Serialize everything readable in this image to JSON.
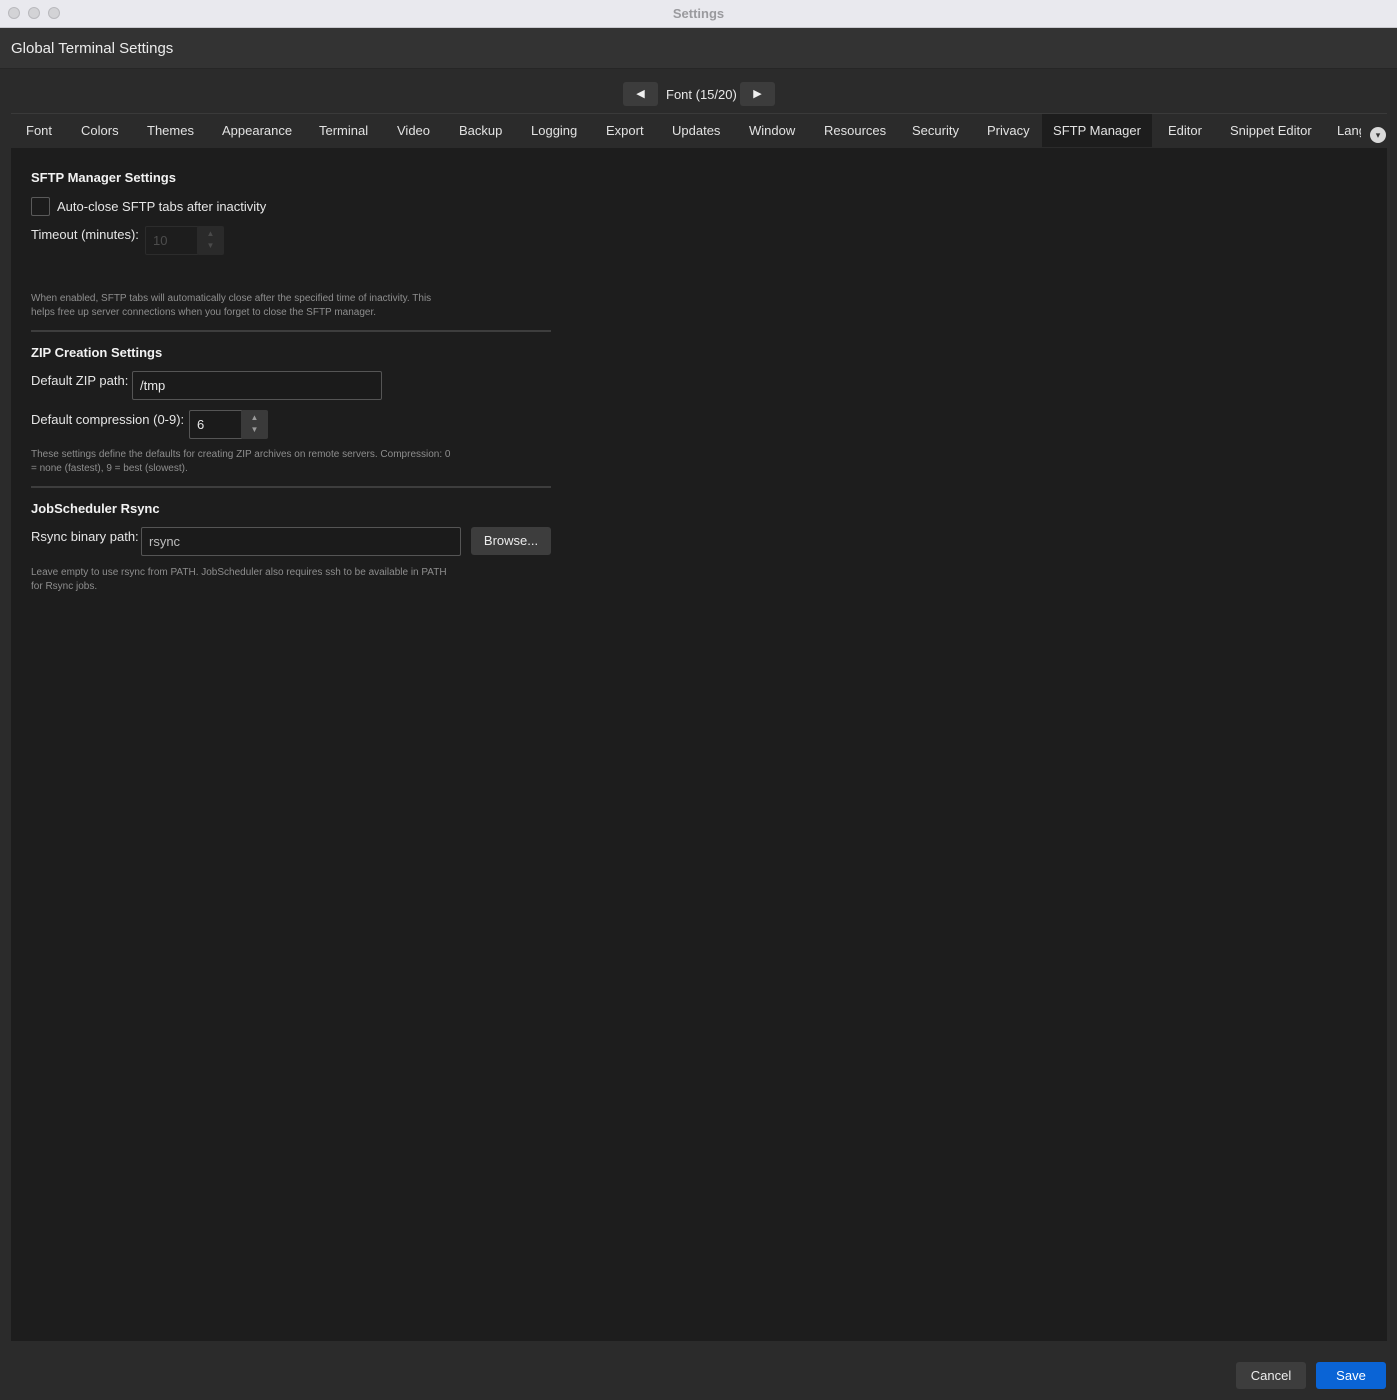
{
  "window": {
    "title": "Settings"
  },
  "header": {
    "title": "Global Terminal Settings"
  },
  "pager": {
    "prev": "◀",
    "label": "Font (15/20)",
    "next": "▶"
  },
  "tabs": [
    {
      "label": "Font"
    },
    {
      "label": "Colors"
    },
    {
      "label": "Themes"
    },
    {
      "label": "Appearance"
    },
    {
      "label": "Terminal"
    },
    {
      "label": "Video"
    },
    {
      "label": "Backup"
    },
    {
      "label": "Logging"
    },
    {
      "label": "Export"
    },
    {
      "label": "Updates"
    },
    {
      "label": "Window"
    },
    {
      "label": "Resources"
    },
    {
      "label": "Security"
    },
    {
      "label": "Privacy"
    },
    {
      "label": "SFTP Manager"
    },
    {
      "label": "Editor"
    },
    {
      "label": "Snippet Editor"
    },
    {
      "label": "Lang"
    }
  ],
  "active_tab": "SFTP Manager",
  "sftp": {
    "title": "SFTP Manager Settings",
    "auto_close_label": "Auto-close SFTP tabs after inactivity",
    "auto_close_checked": false,
    "timeout_label": "Timeout (minutes):",
    "timeout_value": "10",
    "help": "When enabled, SFTP tabs will automatically close after the specified time of inactivity. This helps free up server connections when you forget to close the SFTP manager."
  },
  "zip": {
    "title": "ZIP Creation Settings",
    "path_label": "Default ZIP path:",
    "path_value": "/tmp",
    "compression_label": "Default compression (0-9):",
    "compression_value": "6",
    "help": "These settings define the defaults for creating ZIP archives on remote servers. Compression: 0 = none (fastest), 9 = best (slowest)."
  },
  "rsync": {
    "title": "JobScheduler Rsync",
    "path_label": "Rsync binary path:",
    "path_value": "rsync",
    "browse_label": "Browse...",
    "help": "Leave empty to use rsync from PATH. JobScheduler also requires ssh to be available in PATH for Rsync jobs."
  },
  "footer": {
    "cancel_label": "Cancel",
    "save_label": "Save"
  },
  "colors": {
    "accent": "#0a64d6",
    "panel": "#1d1d1d",
    "chrome": "#2b2b2b"
  },
  "icons": {
    "spin_up": "▲",
    "spin_down": "▼",
    "tab_menu": "▾"
  }
}
